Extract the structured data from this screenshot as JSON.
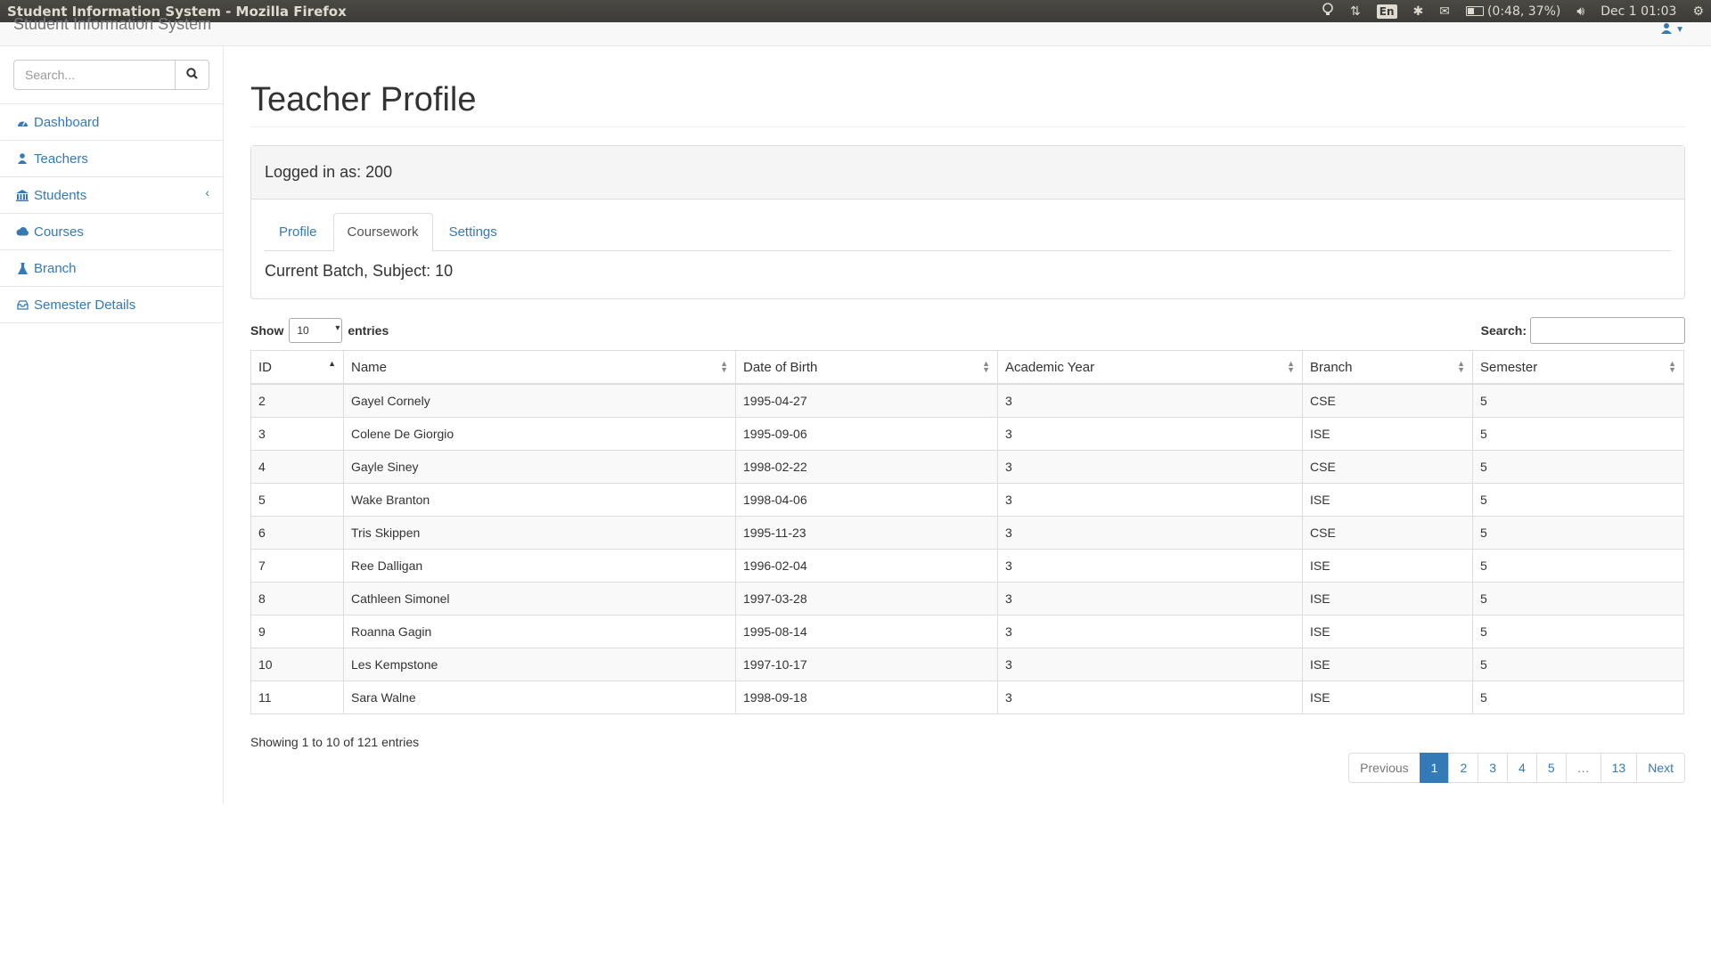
{
  "os": {
    "window_title": "Student Information System - Mozilla Firefox",
    "keyboard": "En",
    "battery": "(0:48, 37%)",
    "clock": "Dec 1 01:03"
  },
  "navbar": {
    "brand": "Student Information System"
  },
  "sidebar": {
    "search_placeholder": "Search...",
    "items": [
      {
        "label": "Dashboard",
        "icon": "dashboard-icon"
      },
      {
        "label": "Teachers",
        "icon": "user-icon"
      },
      {
        "label": "Students",
        "icon": "institution-icon"
      },
      {
        "label": "Courses",
        "icon": "cloud-icon"
      },
      {
        "label": "Branch",
        "icon": "flask-icon"
      },
      {
        "label": "Semester Details",
        "icon": "inbox-icon"
      }
    ]
  },
  "main": {
    "title": "Teacher Profile",
    "logged_in": "Logged in as: 200",
    "tabs": [
      {
        "label": "Profile",
        "active": false
      },
      {
        "label": "Coursework",
        "active": true
      },
      {
        "label": "Settings",
        "active": false
      }
    ],
    "batch": "Current Batch, Subject: 10"
  },
  "table": {
    "show_label": "Show",
    "length_value": "10",
    "entries_label": "entries",
    "search_label": "Search:",
    "search_value": "",
    "columns": [
      "ID",
      "Name",
      "Date of Birth",
      "Academic Year",
      "Branch",
      "Semester"
    ],
    "rows": [
      [
        "2",
        "Gayel Cornely",
        "1995-04-27",
        "3",
        "CSE",
        "5"
      ],
      [
        "3",
        "Colene De Giorgio",
        "1995-09-06",
        "3",
        "ISE",
        "5"
      ],
      [
        "4",
        "Gayle Siney",
        "1998-02-22",
        "3",
        "CSE",
        "5"
      ],
      [
        "5",
        "Wake Branton",
        "1998-04-06",
        "3",
        "ISE",
        "5"
      ],
      [
        "6",
        "Tris Skippen",
        "1995-11-23",
        "3",
        "CSE",
        "5"
      ],
      [
        "7",
        "Ree Dalligan",
        "1996-02-04",
        "3",
        "ISE",
        "5"
      ],
      [
        "8",
        "Cathleen Simonel",
        "1997-03-28",
        "3",
        "ISE",
        "5"
      ],
      [
        "9",
        "Roanna Gagin",
        "1995-08-14",
        "3",
        "ISE",
        "5"
      ],
      [
        "10",
        "Les Kempstone",
        "1997-10-17",
        "3",
        "ISE",
        "5"
      ],
      [
        "11",
        "Sara Walne",
        "1998-09-18",
        "3",
        "ISE",
        "5"
      ]
    ],
    "info": "Showing 1 to 10 of 121 entries",
    "pagination": [
      "Previous",
      "1",
      "2",
      "3",
      "4",
      "5",
      "…",
      "13",
      "Next"
    ],
    "active_page": "1"
  },
  "colors": {
    "link": "#337ab7",
    "os_bar": "#3c3b37"
  }
}
